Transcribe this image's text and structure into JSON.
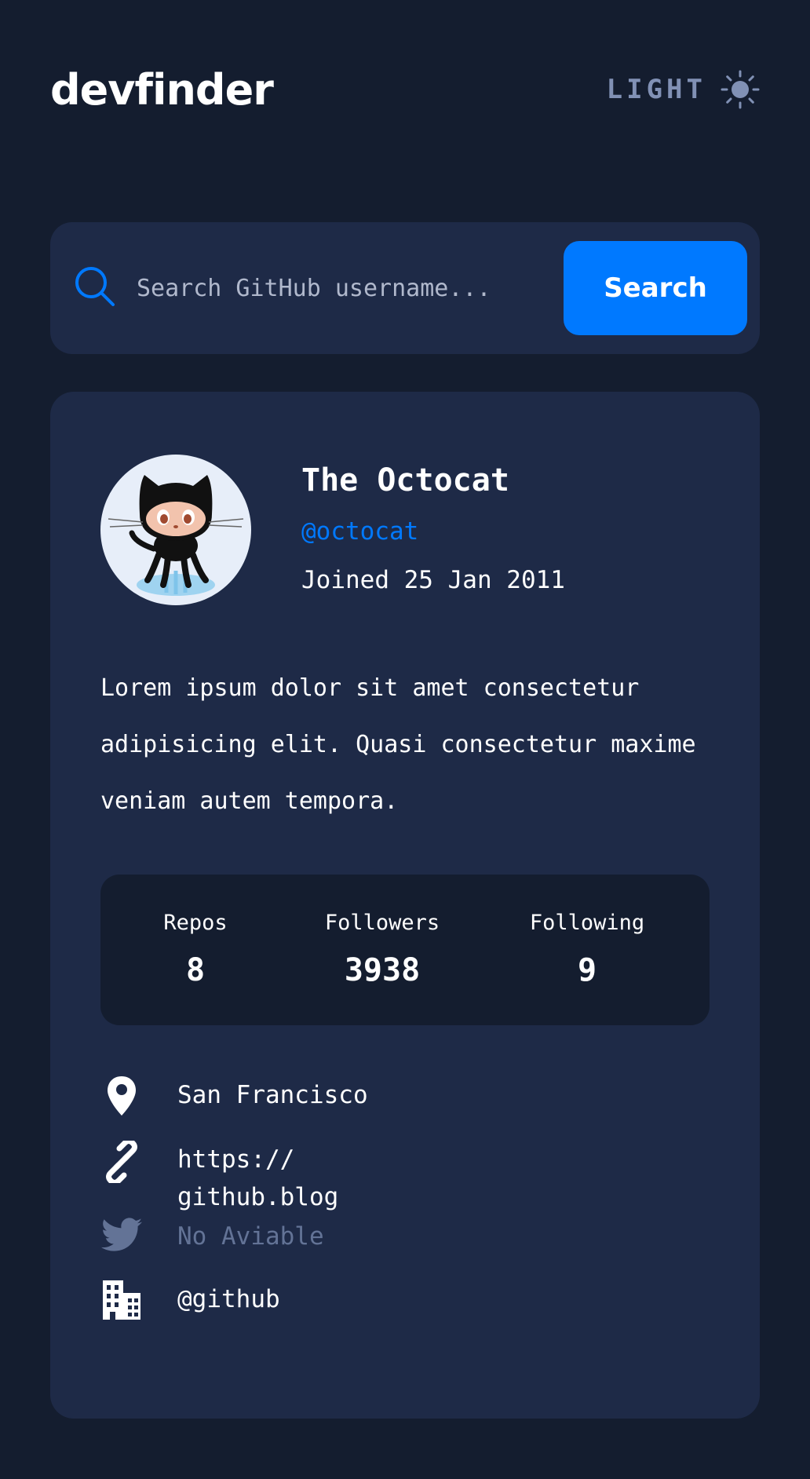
{
  "header": {
    "logo": "devfinder",
    "theme_toggle_label": "LIGHT"
  },
  "search": {
    "placeholder": "Search GitHub username...",
    "value": "",
    "button_label": "Search"
  },
  "profile": {
    "name": "The Octocat",
    "login": "@octocat",
    "joined": "Joined 25 Jan 2011",
    "bio": "Lorem ipsum dolor sit amet consectetur adipisicing elit. Quasi consectetur maxime veniam autem tempora."
  },
  "stats": {
    "repos": {
      "label": "Repos",
      "value": "8"
    },
    "followers": {
      "label": "Followers",
      "value": "3938"
    },
    "following": {
      "label": "Following",
      "value": "9"
    }
  },
  "links": {
    "location": {
      "icon": "location-pin-icon",
      "text": "San Francisco"
    },
    "website": {
      "icon": "link-icon",
      "text_line1": "https://",
      "text_line2": "github.blog"
    },
    "twitter": {
      "icon": "twitter-icon",
      "text": "No Aviable"
    },
    "company": {
      "icon": "building-icon",
      "text": "@github"
    }
  },
  "colors": {
    "background": "#141d2f",
    "card": "#1e2a47",
    "accent": "#0079ff",
    "muted": "#637396",
    "toggle": "#8191b5"
  }
}
